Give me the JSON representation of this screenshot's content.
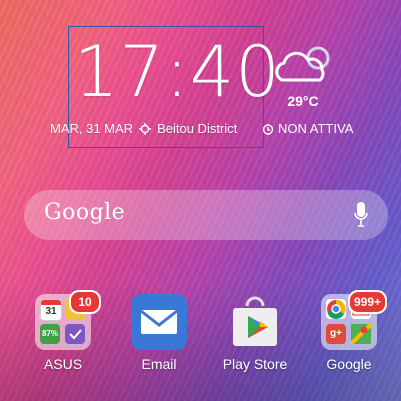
{
  "clock": {
    "time": "17:40"
  },
  "date": {
    "date_text": "MAR, 31 MAR",
    "location": "Beitou District"
  },
  "weather": {
    "temp": "29°C"
  },
  "alarm": {
    "status": "NON ATTIVA"
  },
  "search": {
    "brand": "Google"
  },
  "dock": {
    "apps": [
      {
        "label": "ASUS",
        "badge": "10"
      },
      {
        "label": "Email"
      },
      {
        "label": "Play Store"
      },
      {
        "label": "Google",
        "badge": "999+"
      }
    ]
  }
}
